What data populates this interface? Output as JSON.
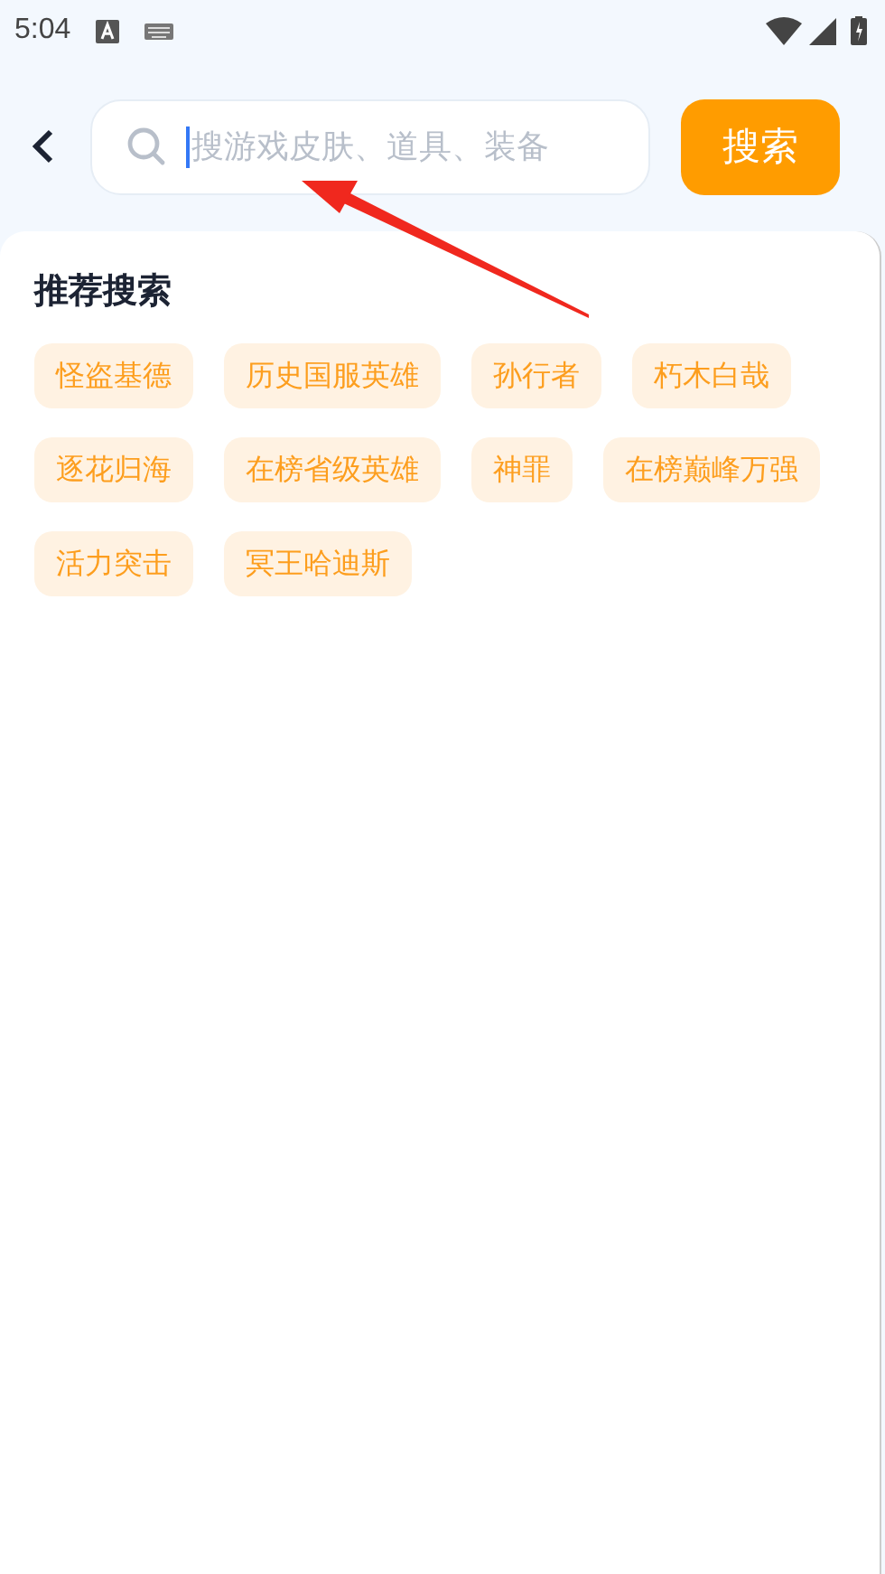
{
  "status_bar": {
    "time": "5:04"
  },
  "search": {
    "placeholder": "搜游戏皮肤、道具、装备",
    "button": "搜索"
  },
  "recommended": {
    "title": "推荐搜索",
    "tags": [
      {
        "label": "怪盗基德"
      },
      {
        "label": "历史国服英雄"
      },
      {
        "label": "孙行者"
      },
      {
        "label": "朽木白哉"
      },
      {
        "label": "逐花归海"
      },
      {
        "label": "在榜省级英雄"
      },
      {
        "label": "神罪"
      },
      {
        "label": "在榜巅峰万强"
      },
      {
        "label": "活力突击"
      },
      {
        "label": "冥王哈迪斯"
      }
    ]
  }
}
